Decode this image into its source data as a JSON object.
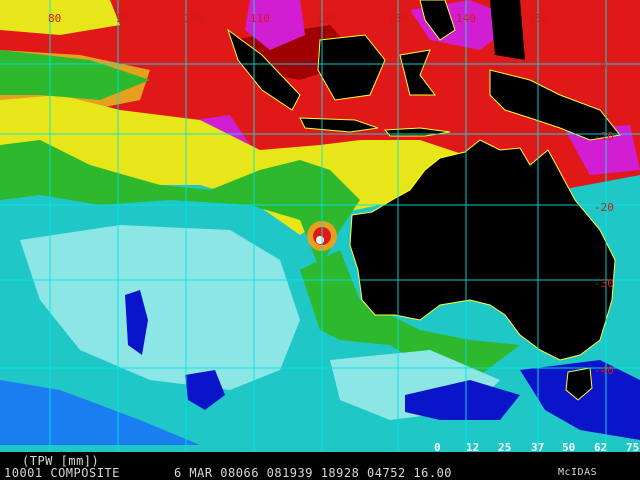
{
  "map": {
    "lon_labels": [
      "80",
      "90",
      "100",
      "110",
      "120",
      "130",
      "140",
      "150"
    ],
    "lat_labels": [
      "0",
      "-10",
      "-20",
      "-30",
      "-40"
    ],
    "colors": {
      "ocean_dry": "#1fc7c7",
      "ocean_drier": "#8de6e6",
      "very_dry": "#0a14c8",
      "low": "#1a7ef0",
      "mid_green": "#2eb82e",
      "yellow": "#e6e619",
      "orange": "#e6a020",
      "red": "#e01818",
      "dark_red": "#a00000",
      "magenta": "#d21ed2",
      "land": "#000000",
      "coastline": "#ffff33",
      "grid": "#00e5e5"
    }
  },
  "status": {
    "product_label": "(TPW [mm])",
    "line": "10001 COMPOSITE       6 MAR 08066 081939 18928 04752 16.00",
    "credit": "McIDAS"
  },
  "legend": {
    "ticks": [
      "0",
      "12",
      "25",
      "37",
      "50",
      "62",
      "75"
    ],
    "colors": [
      "#2020e0",
      "#1a7ef0",
      "#1fc7c7",
      "#2eb82e",
      "#a8e619",
      "#e6e619",
      "#e6a020",
      "#e01818",
      "#a00000",
      "#d21ed2",
      "#ff66ff"
    ]
  }
}
